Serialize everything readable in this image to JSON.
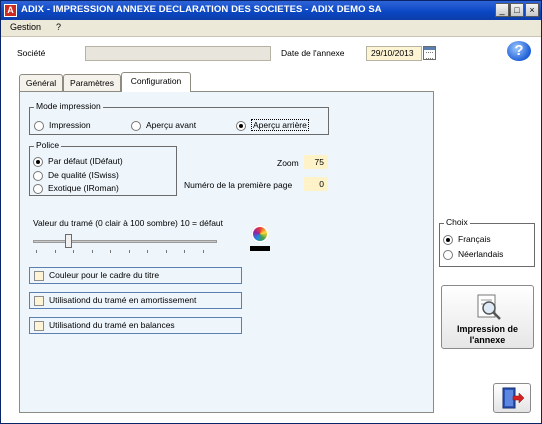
{
  "window": {
    "title": "ADIX - IMPRESSION ANNEXE DECLARATION DES SOCIETES - ADIX DEMO SA",
    "icon_letter": "A",
    "minimize": "_",
    "maximize": "□",
    "close": "×"
  },
  "menu": [
    "Gestion",
    "?"
  ],
  "header": {
    "societe_label": "Société",
    "societe_value": "",
    "date_label": "Date de l'annexe",
    "date_value": "29/10/2013"
  },
  "tabs": [
    {
      "label": "Général",
      "active": false
    },
    {
      "label": "Paramètres",
      "active": false
    },
    {
      "label": "Configuration",
      "active": true
    }
  ],
  "mode_impression": {
    "title": "Mode impression",
    "options": [
      {
        "label": "Impression",
        "selected": false
      },
      {
        "label": "Aperçu avant",
        "selected": false
      },
      {
        "label": "Aperçu arrière",
        "selected": true
      }
    ]
  },
  "police": {
    "title": "Police",
    "options": [
      {
        "label": "Par défaut (IDéfaut)",
        "selected": true
      },
      {
        "label": "De qualité (ISwiss)",
        "selected": false
      },
      {
        "label": "Exotique (IRoman)",
        "selected": false
      }
    ]
  },
  "zoom": {
    "label": "Zoom",
    "value": "75"
  },
  "first_page": {
    "label": "Numéro de la première page",
    "value": "0"
  },
  "trame": {
    "label": "Valeur du tramé (0 clair à 100 sombre)  10 = défaut",
    "value": 10,
    "min": 0,
    "max": 100
  },
  "options": [
    {
      "label": "Couleur pour le cadre du titre",
      "checked": false
    },
    {
      "label": "Utilisationd du tramé en amortissement",
      "checked": false
    },
    {
      "label": "Utilisationd du tramé en balances",
      "checked": false
    }
  ],
  "choix": {
    "title": "Choix",
    "options": [
      {
        "label": "Français",
        "selected": true
      },
      {
        "label": "Néerlandais",
        "selected": false
      }
    ]
  },
  "buttons": {
    "print_line1": "Impression de",
    "print_line2": "l'annexe"
  },
  "icons": {
    "help": "help-icon",
    "calendar": "calendar-icon",
    "color": "color-picker-icon",
    "print": "print-preview-icon",
    "exit": "exit-door-icon"
  }
}
